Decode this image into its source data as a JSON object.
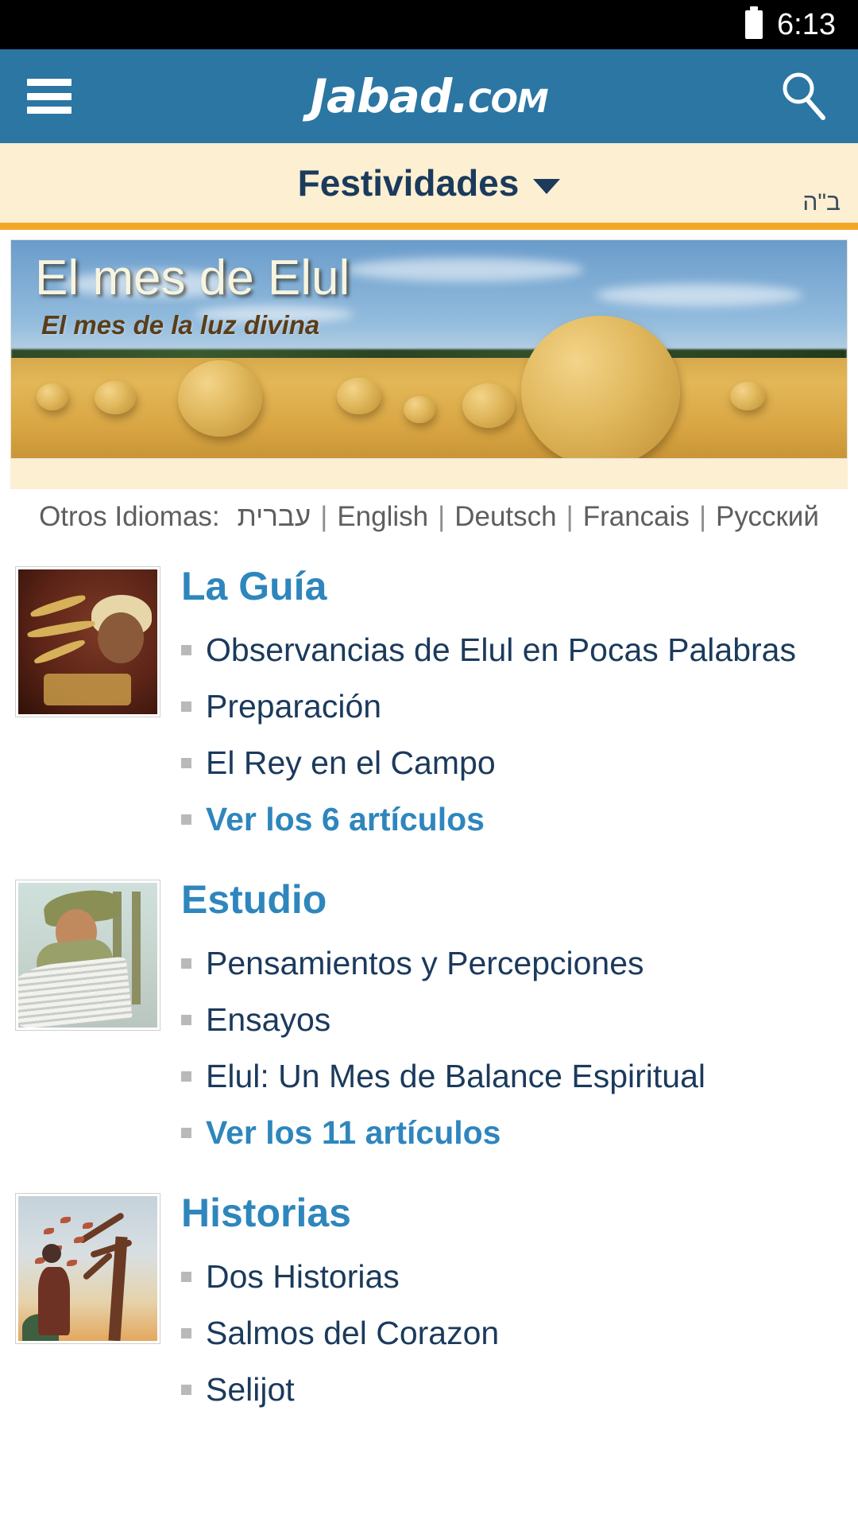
{
  "status_bar": {
    "time": "6:13",
    "battery_icon": "battery-icon"
  },
  "app_bar": {
    "menu_icon": "hamburger-menu-icon",
    "brand_name": "Jabad",
    "brand_dot": ".",
    "brand_tld": "COM",
    "search_icon": "search-icon"
  },
  "nav_bar": {
    "title": "Festividades",
    "caret_icon": "chevron-down-icon",
    "bh_marker": "ב\"ה"
  },
  "banner": {
    "title": "El mes de Elul",
    "subtitle": "El mes de la luz divina"
  },
  "languages": {
    "label": "Otros Idiomas:",
    "items": [
      {
        "label": "עברית"
      },
      {
        "label": "English"
      },
      {
        "label": "Deutsch"
      },
      {
        "label": "Francais"
      },
      {
        "label": "Русский"
      }
    ],
    "separator": "|"
  },
  "sections": [
    {
      "title": "La Guía",
      "thumbnail": "torah-scroll-thumbnail",
      "links": [
        {
          "label": "Observancias de Elul en Pocas Palabras",
          "more": false
        },
        {
          "label": "Preparación",
          "more": false
        },
        {
          "label": "El Rey en el Campo",
          "more": false
        },
        {
          "label": "Ver los 6 artículos",
          "more": true
        }
      ]
    },
    {
      "title": "Estudio",
      "thumbnail": "scholar-studying-thumbnail",
      "links": [
        {
          "label": "Pensamientos y Percepciones",
          "more": false
        },
        {
          "label": "Ensayos",
          "more": false
        },
        {
          "label": "Elul: Un Mes de Balance Espiritual",
          "more": false
        },
        {
          "label": "Ver los 11 artículos",
          "more": true
        }
      ]
    },
    {
      "title": "Historias",
      "thumbnail": "autumn-tree-thumbnail",
      "links": [
        {
          "label": "Dos Historias",
          "more": false
        },
        {
          "label": "Salmos del Corazon",
          "more": false
        },
        {
          "label": "Selijot",
          "more": false
        }
      ]
    }
  ],
  "colors": {
    "status_bar_bg": "#000000",
    "app_bar_bg": "#2b76a3",
    "nav_bar_bg": "#fcefd2",
    "gold_rule": "#f2a826",
    "heading_blue": "#2e86bd",
    "link_navy": "#1b3a5c",
    "muted_grey": "#5e5e5e"
  }
}
